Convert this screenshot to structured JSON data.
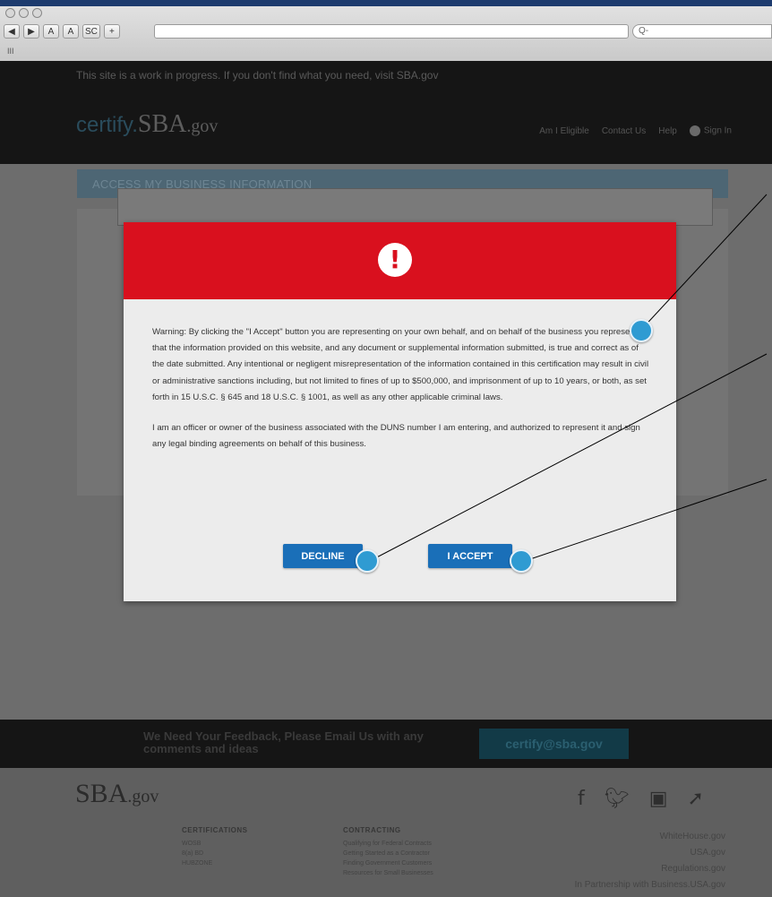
{
  "browser": {
    "toolbar_buttons": [
      "◀",
      "▶",
      "A",
      "A",
      "SC",
      "+"
    ],
    "search_placeholder": "Q-",
    "bookmarks_label": "III"
  },
  "site": {
    "notice": "This site is a work in progress. If you don't find what you need, visit SBA.gov",
    "logo_certify": "certify.",
    "logo_sba": "SBA",
    "logo_gov": ".gov",
    "nav": [
      "Am I Eligible",
      "Contact Us",
      "Help"
    ],
    "nav_user": "Sign In"
  },
  "section": {
    "title": "ACCESS MY BUSINESS INFORMATION"
  },
  "modal": {
    "icon": "!",
    "paragraph1": "Warning:  By clicking the \"I Accept\" button you are representing on your own behalf, and on behalf of the business you represent, that the information provided on this website, and any document or supplemental information submitted, is true and correct as of the date submitted. Any intentional or negligent misrepresentation of the information contained in this certification may result in civil or administrative sanctions including, but not limited to fines of up to $500,000, and imprisonment of up to 10 years, or both, as set forth in 15 U.S.C. § 645 and 18 U.S.C. § 1001, as well as any other applicable criminal laws.",
    "paragraph2": "I am an officer or owner of the business associated with the DUNS number I am entering, and authorized to represent it and sign any legal binding agreements on behalf of this business.",
    "decline_label": "DECLINE",
    "accept_label": "I ACCEPT"
  },
  "feedback": {
    "text": "We Need Your Feedback, Please Email Us with any comments and ideas",
    "email": "certify@sba.gov"
  },
  "footer": {
    "logo_sba": "SBA",
    "logo_gov": ".gov",
    "certifications_heading": "CERTIFICATIONS",
    "certifications": [
      "WOSB",
      "8(a) BD",
      "HUBZONE"
    ],
    "contracting_heading": "CONTRACTING",
    "contracting": [
      "Qualifying for Federal Contracts",
      "Getting Started as a Contractor",
      "Finding Government Customers",
      "Resources for Small Businesses"
    ],
    "links": [
      "WhiteHouse.gov",
      "USA.gov",
      "Regulations.gov",
      "In Partnership with Business.USA.gov"
    ]
  },
  "colors": {
    "modal_header": "#d9101e",
    "button": "#1a6fb8",
    "callout": "#2f9bd2"
  }
}
